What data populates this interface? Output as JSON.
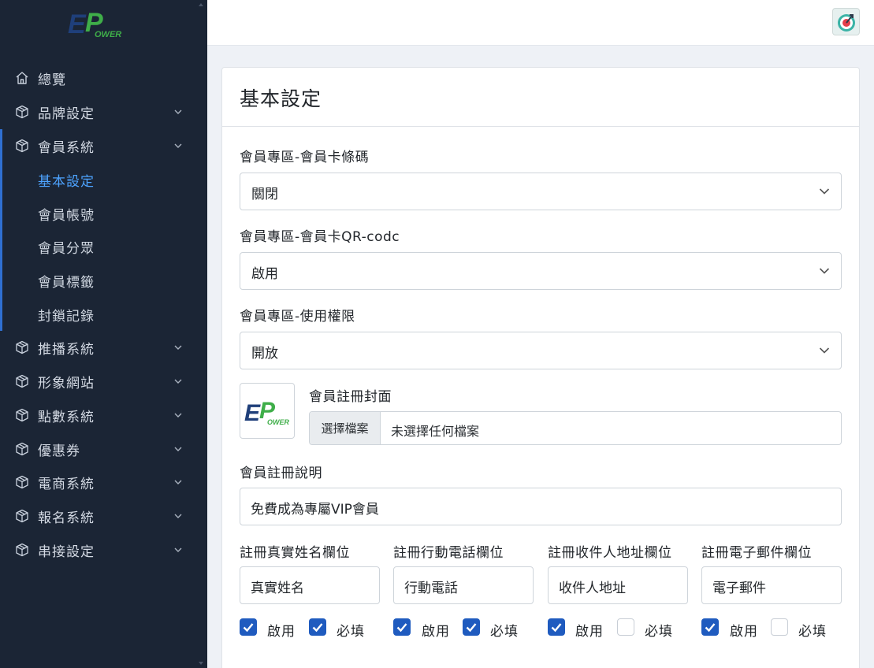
{
  "sidebar": {
    "logo_text": "EPower",
    "items": [
      {
        "label": "總覽",
        "icon": "home-icon"
      },
      {
        "label": "品牌設定",
        "icon": "box-icon"
      },
      {
        "label": "會員系統",
        "icon": "box-icon"
      },
      {
        "label": "推播系統",
        "icon": "box-icon"
      },
      {
        "label": "形象網站",
        "icon": "box-icon"
      },
      {
        "label": "點數系統",
        "icon": "box-icon"
      },
      {
        "label": "優惠券",
        "icon": "box-icon"
      },
      {
        "label": "電商系統",
        "icon": "box-icon"
      },
      {
        "label": "報名系統",
        "icon": "box-icon"
      },
      {
        "label": "串接設定",
        "icon": "box-icon"
      }
    ],
    "sub_items": [
      {
        "label": "基本設定",
        "active": true
      },
      {
        "label": "會員帳號",
        "active": false
      },
      {
        "label": "會員分眾",
        "active": false
      },
      {
        "label": "會員標籤",
        "active": false
      },
      {
        "label": "封鎖記錄",
        "active": false
      }
    ],
    "accent_color": "#4da3ff"
  },
  "header": {
    "avatar_icon": "user-avatar-icon"
  },
  "main": {
    "title": "基本設定",
    "barcode": {
      "label": "會員專區-會員卡條碼",
      "value": "關閉"
    },
    "qrcode": {
      "label": "會員專區-會員卡QR-codc",
      "value": "啟用"
    },
    "permission": {
      "label": "會員專區-使用權限",
      "value": "開放"
    },
    "cover": {
      "label": "會員註冊封面",
      "button": "選擇檔案",
      "file_status": "未選擇任何檔案"
    },
    "description": {
      "label": "會員註冊說明",
      "value": "免費成為專屬VIP會員"
    },
    "fields": [
      {
        "label": "註冊真實姓名欄位",
        "value": "真實姓名",
        "enable_label": "啟用",
        "required_label": "必填",
        "enabled": true,
        "required": true
      },
      {
        "label": "註冊行動電話欄位",
        "value": "行動電話",
        "enable_label": "啟用",
        "required_label": "必填",
        "enabled": true,
        "required": true
      },
      {
        "label": "註冊收件人地址欄位",
        "value": "收件人地址",
        "enable_label": "啟用",
        "required_label": "必填",
        "enabled": true,
        "required": false
      },
      {
        "label": "註冊電子郵件欄位",
        "value": "電子郵件",
        "enable_label": "啟用",
        "required_label": "必填",
        "enabled": true,
        "required": false
      }
    ],
    "checkbox_color": "#1f5bbf"
  }
}
